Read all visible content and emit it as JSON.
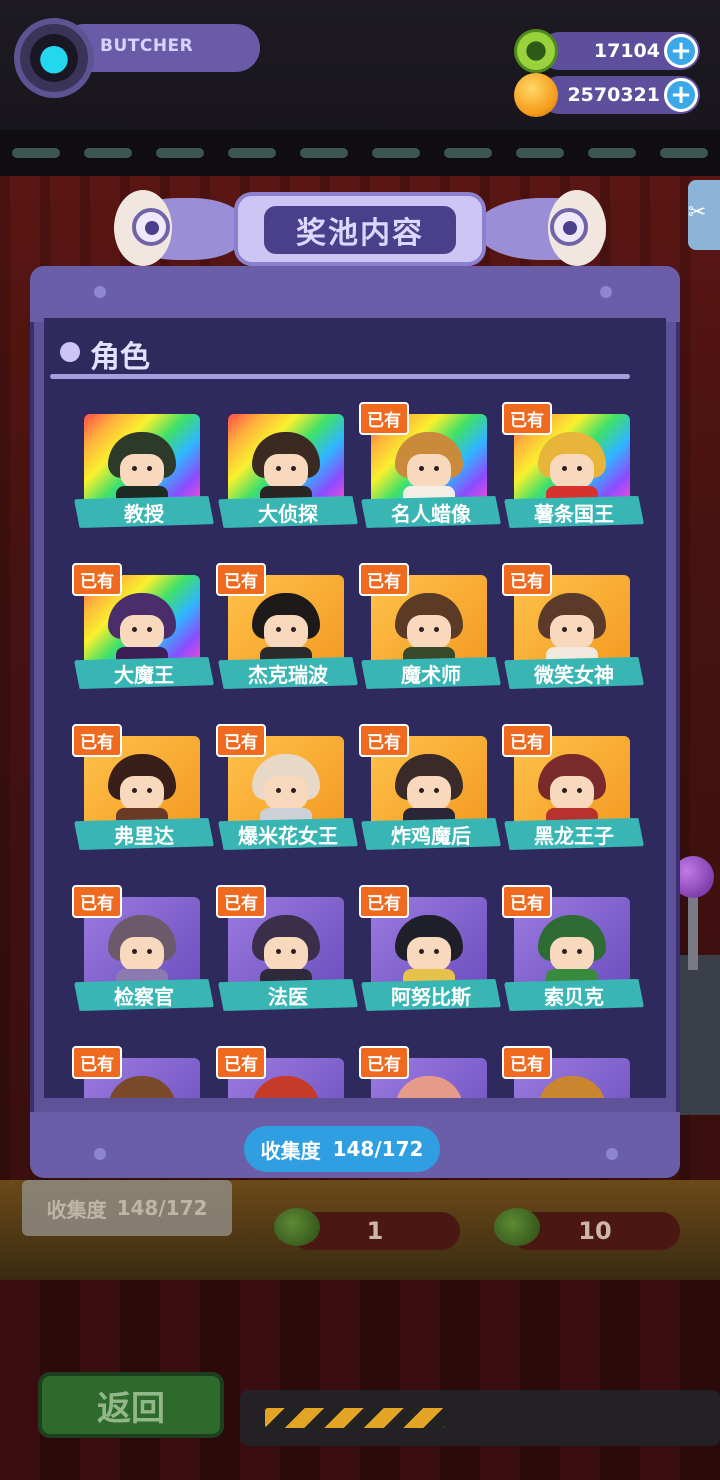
{
  "player": {
    "name": "BUTCHER"
  },
  "resources": [
    {
      "icon": "green-gem-icon",
      "value": "17104"
    },
    {
      "icon": "planet-coin-icon",
      "value": "2570321"
    }
  ],
  "modal": {
    "title": "奖池内容",
    "section_title": "角色",
    "owned_label": "已有",
    "collection_label": "收集度",
    "collection_value": "148/172"
  },
  "characters": [
    {
      "name": "教授",
      "frame": "rainbow",
      "owned": false
    },
    {
      "name": "大侦探",
      "frame": "rainbow",
      "owned": false
    },
    {
      "name": "名人蜡像",
      "frame": "rainbow",
      "owned": true
    },
    {
      "name": "薯条国王",
      "frame": "rainbow",
      "owned": true
    },
    {
      "name": "大魔王",
      "frame": "rainbow",
      "owned": true
    },
    {
      "name": "杰克瑞波",
      "frame": "gold",
      "owned": true
    },
    {
      "name": "魔术师",
      "frame": "gold",
      "owned": true
    },
    {
      "name": "微笑女神",
      "frame": "gold",
      "owned": true
    },
    {
      "name": "弗里达",
      "frame": "gold",
      "owned": true
    },
    {
      "name": "爆米花女王",
      "frame": "gold",
      "owned": true
    },
    {
      "name": "炸鸡魔后",
      "frame": "gold",
      "owned": true
    },
    {
      "name": "黑龙王子",
      "frame": "gold",
      "owned": true
    },
    {
      "name": "检察官",
      "frame": "purple",
      "owned": true
    },
    {
      "name": "法医",
      "frame": "purple",
      "owned": true
    },
    {
      "name": "阿努比斯",
      "frame": "purple",
      "owned": true
    },
    {
      "name": "索贝克",
      "frame": "purple",
      "owned": true
    },
    {
      "name": "",
      "frame": "purple",
      "owned": true
    },
    {
      "name": "",
      "frame": "purple",
      "owned": true
    },
    {
      "name": "",
      "frame": "purple",
      "owned": true
    },
    {
      "name": "",
      "frame": "purple",
      "owned": true
    }
  ],
  "background": {
    "collection_label": "收集度",
    "collection_value": "148/172",
    "counter_left": "1",
    "counter_right": "10",
    "back_button": "返回"
  },
  "colors": {
    "owned_badge": "#ef6a1e",
    "name_ribbon": "#39b6b4",
    "panel": "#2f2a5e",
    "collection_pill": "#2f9fe2"
  }
}
